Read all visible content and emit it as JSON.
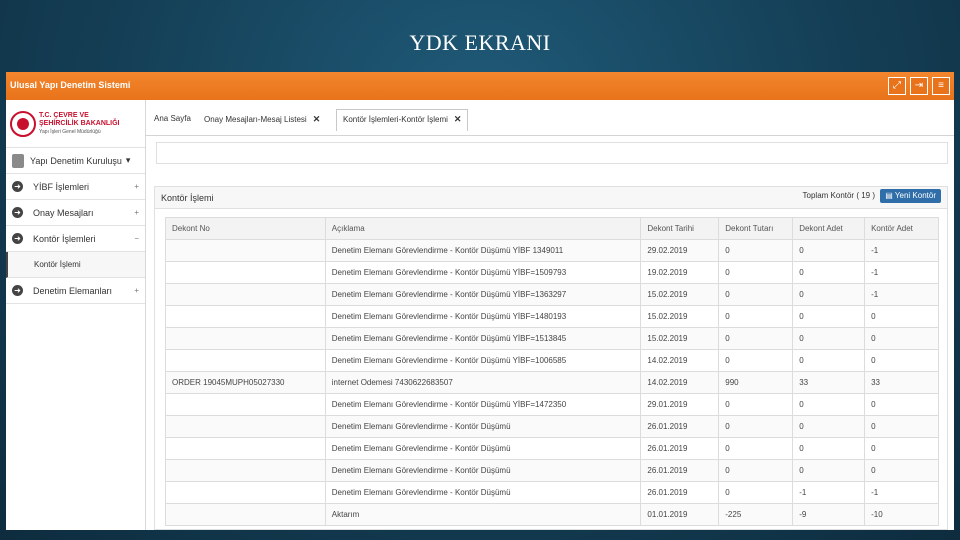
{
  "slide": {
    "title": "YDK EKRANI"
  },
  "app": {
    "title": "Ulusal Yapı Denetim Sistemi",
    "toolbar_icons": [
      "expand-icon",
      "logout-icon",
      "menu-icon"
    ]
  },
  "logo": {
    "line1": "T.C. ÇEVRE VE",
    "line2": "ŞEHİRCİLİK BAKANLIĞI",
    "line3": "Yapı İşleri Genel Müdürlüğü"
  },
  "sidebar": {
    "user": "Yapı Denetim Kuruluşu",
    "items": [
      {
        "label": "YİBF İşlemleri",
        "toggle": "+"
      },
      {
        "label": "Onay Mesajları",
        "toggle": "+"
      },
      {
        "label": "Kontör İşlemleri",
        "toggle": "−",
        "children": [
          "Kontör İşlemi"
        ]
      },
      {
        "label": "Denetim Elemanları",
        "toggle": "+"
      }
    ]
  },
  "tabs": [
    {
      "label": "Ana Sayfa"
    },
    {
      "label": "Onay Mesajları-Mesaj Listesi"
    },
    {
      "label": "Kontör İşlemleri-Kontör İşlemi"
    }
  ],
  "panel": {
    "title": "Kontör İşlemi",
    "total": "Toplam Kontör ( 19 )",
    "new_button": "Yeni Kontör"
  },
  "table": {
    "columns": [
      "Dekont No",
      "Açıklama",
      "Dekont Tarihi",
      "Dekont Tutarı",
      "Dekont Adet",
      "Kontör Adet"
    ],
    "rows": [
      [
        "",
        "Denetim Elemanı Görevlendirme - Kontör Düşümü YİBF 1349011",
        "29.02.2019",
        "0",
        "0",
        "-1"
      ],
      [
        "",
        "Denetim Elemanı Görevlendirme - Kontör Düşümü YİBF=1509793",
        "19.02.2019",
        "0",
        "0",
        "-1"
      ],
      [
        "",
        "Denetim Elemanı Görevlendirme - Kontör Düşümü YİBF=1363297",
        "15.02.2019",
        "0",
        "0",
        "-1"
      ],
      [
        "",
        "Denetim Elemanı Görevlendirme - Kontör Düşümü YİBF=1480193",
        "15.02.2019",
        "0",
        "0",
        "0"
      ],
      [
        "",
        "Denetim Elemanı Görevlendirme - Kontör Düşümü YİBF=1513845",
        "15.02.2019",
        "0",
        "0",
        "0"
      ],
      [
        "",
        "Denetim Elemanı Görevlendirme - Kontör Düşümü YİBF=1006585",
        "14.02.2019",
        "0",
        "0",
        "0"
      ],
      [
        "ORDER 19045MUPH05027330",
        "internet Odemesi 7430622683507",
        "14.02.2019",
        "990",
        "33",
        "33"
      ],
      [
        "",
        "Denetim Elemanı Görevlendirme - Kontör Düşümü YİBF=1472350",
        "29.01.2019",
        "0",
        "0",
        "0"
      ],
      [
        "",
        "Denetim Elemanı Görevlendirme - Kontör Düşümü",
        "26.01.2019",
        "0",
        "0",
        "0"
      ],
      [
        "",
        "Denetim Elemanı Görevlendirme - Kontör Düşümü",
        "26.01.2019",
        "0",
        "0",
        "0"
      ],
      [
        "",
        "Denetim Elemanı Görevlendirme - Kontör Düşümü",
        "26.01.2019",
        "0",
        "0",
        "0"
      ],
      [
        "",
        "Denetim Elemanı Görevlendirme - Kontör Düşümü",
        "26.01.2019",
        "0",
        "-1",
        "-1"
      ],
      [
        "",
        "Aktarım",
        "01.01.2019",
        "-225",
        "-9",
        "-10"
      ]
    ]
  },
  "colors": {
    "topbar": "#e8731a",
    "primary_button": "#2f6ea8",
    "logo_red": "#c8102e"
  }
}
